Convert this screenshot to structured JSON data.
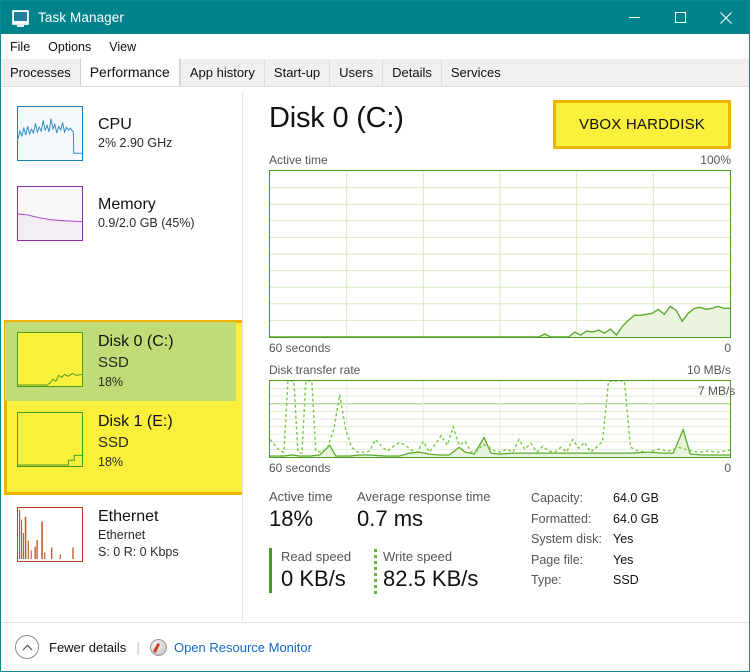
{
  "window": {
    "title": "Task Manager",
    "icon": "task-manager-icon",
    "controls": {
      "minimize": "–",
      "maximize": "□",
      "close": "✕"
    }
  },
  "menubar": {
    "items": [
      "File",
      "Options",
      "View"
    ]
  },
  "tabs": {
    "items": [
      "Processes",
      "Performance",
      "App history",
      "Start-up",
      "Users",
      "Details",
      "Services"
    ],
    "active": "Performance"
  },
  "sidebar": {
    "items": [
      {
        "title": "CPU",
        "sub": "2%  2.90 GHz",
        "sub2": "",
        "color": "#1a7fc1",
        "selected": false,
        "annotated": false
      },
      {
        "title": "Memory",
        "sub": "0.9/2.0 GB (45%)",
        "sub2": "",
        "color": "#8c2fa8",
        "selected": false,
        "annotated": false
      },
      {
        "title": "Disk 0 (C:)",
        "sub": "SSD",
        "sub2": "18%",
        "color": "#4a9a22",
        "selected": true,
        "annotated": true
      },
      {
        "title": "Disk 1 (E:)",
        "sub": "SSD",
        "sub2": "18%",
        "color": "#4a9a22",
        "selected": false,
        "annotated": true
      },
      {
        "title": "Ethernet",
        "sub": "Ethernet",
        "sub2": "S: 0 R: 0 Kbps",
        "color": "#b04a1e",
        "selected": false,
        "annotated": false
      }
    ]
  },
  "main": {
    "title": "Disk 0 (C:)",
    "badge": "VBOX HARDDISK",
    "graph_active": {
      "label": "Active time",
      "max_label": "100%",
      "x_label": "60 seconds",
      "x_right": "0"
    },
    "graph_transfer": {
      "label": "Disk transfer rate",
      "max_label": "10 MB/s",
      "peak_label": "7 MB/s",
      "x_label": "60 seconds",
      "x_right": "0"
    },
    "stats": {
      "active_time_label": "Active time",
      "active_time_value": "18%",
      "avg_response_label": "Average response time",
      "avg_response_value": "0.7 ms",
      "read_speed_label": "Read speed",
      "read_speed_value": "0 KB/s",
      "write_speed_label": "Write speed",
      "write_speed_value": "82.5 KB/s"
    },
    "info": [
      {
        "key": "Capacity:",
        "value": "64.0 GB"
      },
      {
        "key": "Formatted:",
        "value": "64.0 GB"
      },
      {
        "key": "System disk:",
        "value": "Yes"
      },
      {
        "key": "Page file:",
        "value": "Yes"
      },
      {
        "key": "Type:",
        "value": "SSD"
      }
    ]
  },
  "statusbar": {
    "fewer_details": "Fewer details",
    "separator": "|",
    "resource_monitor": "Open Resource Monitor"
  },
  "colors": {
    "titlebar": "#00838a",
    "accent_green": "#4a9a22",
    "highlight_yellow": "#faf03c",
    "annotation_border": "#f0b400",
    "selection_green": "#bfdc76",
    "link_blue": "#1269c7"
  },
  "chart_data": [
    {
      "type": "area",
      "title": "Active time",
      "ylabel": "Active time",
      "xlabel": "60 seconds",
      "ylim": [
        0,
        100
      ],
      "xlim": [
        -60,
        0
      ],
      "grid": true,
      "series": [
        {
          "name": "Active time",
          "values": [
            0,
            0,
            0,
            0,
            0,
            0,
            0,
            0,
            0,
            0,
            0,
            0,
            0,
            0,
            0,
            0,
            0,
            0,
            0,
            0,
            0,
            0,
            0,
            0,
            0,
            0,
            0,
            0,
            0,
            0,
            0,
            0,
            0,
            0,
            0,
            0,
            0,
            0,
            0,
            0,
            0,
            0,
            0,
            0,
            0,
            0,
            0,
            0,
            1.5,
            0,
            0,
            0,
            0,
            2.5,
            1,
            3.5,
            2,
            3,
            3,
            2.5,
            4,
            2,
            4.5,
            2,
            6,
            10,
            13,
            13.5,
            13.5,
            14,
            14,
            15,
            17,
            14,
            18,
            16.5,
            10,
            14,
            17,
            18,
            17.5
          ]
        }
      ]
    },
    {
      "type": "line",
      "title": "Disk transfer rate",
      "ylabel": "MB/s",
      "xlabel": "60 seconds",
      "ylim": [
        0,
        10
      ],
      "xlim": [
        -60,
        0
      ],
      "grid": true,
      "annotations": [
        {
          "text": "7 MB/s",
          "value": 7
        }
      ],
      "series": [
        {
          "name": "Write speed",
          "style": "dashed",
          "values": [
            2.2,
            1.2,
            0.5,
            0.4,
            10,
            10,
            0.5,
            0.4,
            10,
            10,
            0.6,
            0.5,
            1.3,
            3.4,
            9.0,
            3.3,
            0.8,
            0.4,
            0.4,
            0.5,
            2.1,
            0.9,
            0.5,
            0.9,
            1.4,
            1.1,
            0.6,
            0.4,
            2.0,
            0.4,
            1.6,
            2.6,
            1.3,
            3.9,
            1.0,
            1.6,
            0.5,
            0.6,
            1.4,
            0.9,
            0.6,
            0.4,
            0.7,
            0.4,
            2.1,
            0.7,
            1.5,
            0.5,
            1.1,
            0.6,
            0.5,
            1.0,
            0.5,
            1.8,
            0.9,
            1.5,
            10,
            10,
            10,
            1.0,
            0.6,
            0.5,
            0.8
          ]
        },
        {
          "name": "Read speed",
          "style": "solid",
          "values": [
            0.1,
            0.1,
            0.1,
            0.1,
            0.1,
            0.1,
            0.1,
            0.1,
            0.1,
            0.1,
            0.2,
            1.6,
            0.3,
            0.1,
            0.2,
            0.2,
            0.2,
            0.1,
            0.1,
            0.1,
            0.1,
            0.1,
            0.1,
            0.4,
            0.7,
            0.6,
            0.4,
            0.2,
            0.2,
            0.2,
            1.2,
            0.5,
            0.3,
            2.5,
            0.6,
            0.4,
            0.4,
            0.4,
            0.4,
            0.4,
            0.4,
            0.4,
            0.4,
            0.4,
            0.4,
            0.4,
            0.4,
            0.4,
            0.4,
            0.4,
            0.4,
            0.4,
            0.4,
            0.4,
            0.5,
            0.4,
            0.4,
            0.4,
            0.5,
            3.8,
            0.8,
            0.2,
            0.2
          ]
        }
      ]
    }
  ]
}
